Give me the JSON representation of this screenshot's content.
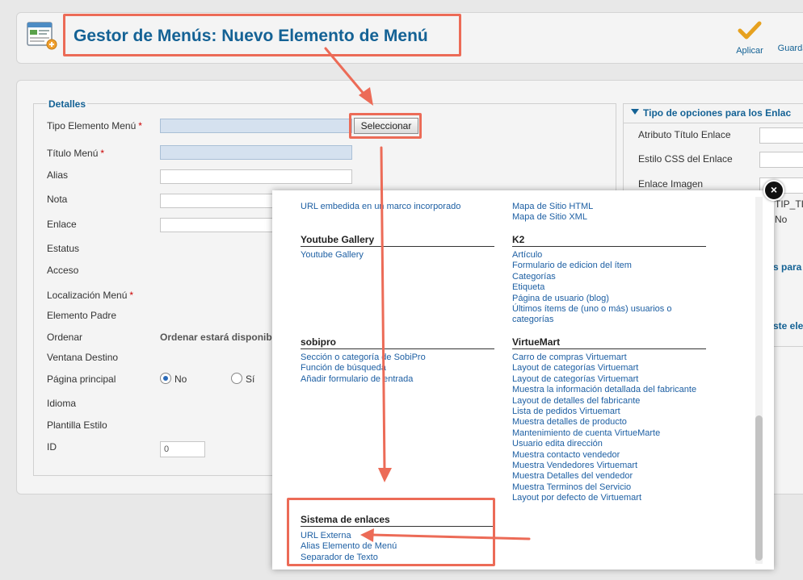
{
  "header": {
    "title": "Gestor de Menús: Nuevo Elemento de Menú",
    "toolbar": {
      "apply_label": "Aplicar",
      "save_label": "Guarda"
    }
  },
  "details": {
    "legend": "Detalles",
    "fields": {
      "tipo": "Tipo Elemento Menú",
      "titulo": "Título Menú",
      "alias": "Alias",
      "nota": "Nota",
      "enlace": "Enlace",
      "estatus": "Estatus",
      "acceso": "Acceso",
      "localizacion": "Localización Menú",
      "padre": "Elemento Padre",
      "ordenar": "Ordenar",
      "ventana": "Ventana Destino",
      "principal": "Página principal",
      "idioma": "Idioma",
      "plantilla": "Plantilla Estilo",
      "id": "ID"
    },
    "required_mark": "*",
    "select_button": "Seleccionar",
    "order_note": "Ordenar estará disponib",
    "radio_no": "No",
    "radio_si": "Sí",
    "id_value": "0"
  },
  "side_panel": {
    "title": "Tipo de opciones para los Enlac",
    "labels": {
      "atributo": "Atributo Título Enlace",
      "css": "Estilo CSS del Enlace",
      "imagen": "Enlace Imagen"
    },
    "fragments": {
      "tip": "TIP_TIT",
      "no": "No",
      "para": "s para",
      "este": "ste ele"
    }
  },
  "modal": {
    "close_glyph": "×",
    "col1_top_item": "URL embedida en un marco incorporado",
    "col2_top_items": [
      "Mapa de Sitio HTML",
      "Mapa de Sitio XML"
    ],
    "youtube": {
      "title": "Youtube Gallery",
      "items": [
        "Youtube Gallery"
      ]
    },
    "k2": {
      "title": "K2",
      "items": [
        "Artículo",
        "Formulario de edicion del ítem",
        "Categorías",
        "Etiqueta",
        "Página de usuario (blog)",
        "Últimos ítems de (uno o más) usuarios o",
        "categorías"
      ]
    },
    "sobipro": {
      "title": "sobipro",
      "items": [
        "Sección o categoría de SobiPro",
        "Función de búsqueda",
        "Añadir formulario de entrada"
      ]
    },
    "virtuemart": {
      "title": "VirtueMart",
      "items": [
        "Carro de compras Virtuemart",
        "Layout de categorías Virtuemart",
        "Layout de categorías Virtuemart",
        "Muestra la información detallada del fabricante",
        "Layout de detalles del fabricante",
        "Lista de pedidos Virtuemart",
        "Muestra detalles de producto",
        "Mantenimiento de cuenta VirtueMarte",
        "Usuario edita dirección",
        "Muestra contacto vendedor",
        "Muestra Vendedores Virtuemart",
        "Muestra Detalles del vendedor",
        "Muestra Terminos del Servicio",
        "Layout por defecto de Virtuemart"
      ]
    },
    "sistema": {
      "title": "Sistema de enlaces",
      "items": [
        "URL Externa",
        "Alias Elemento de Menú",
        "Separador de Texto"
      ]
    }
  },
  "colors": {
    "title_blue": "#146295",
    "link_blue": "#1d5fa3",
    "annotation_red": "#ec6b57"
  }
}
